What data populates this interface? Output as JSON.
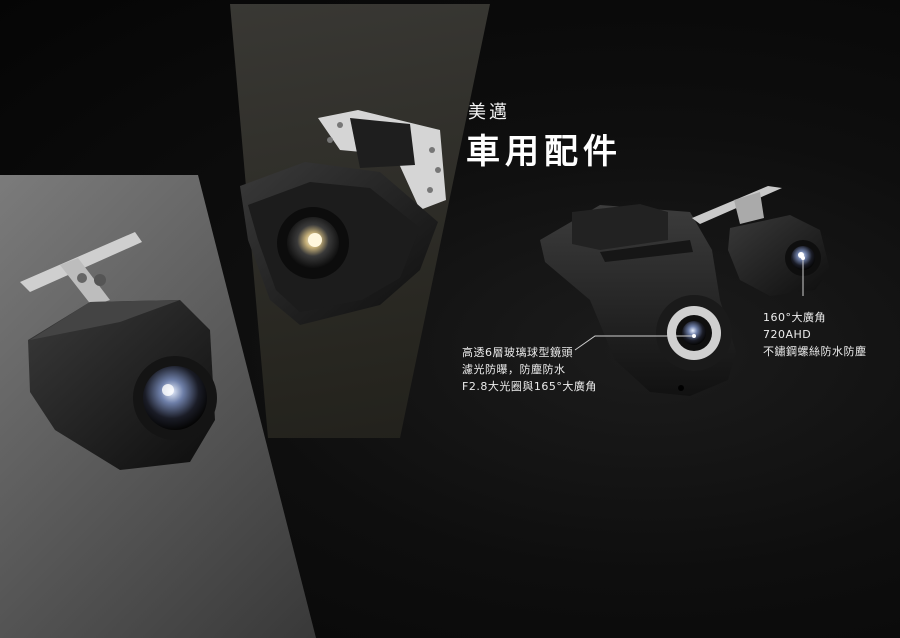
{
  "header": {
    "brand": "美邁",
    "title": "車用配件"
  },
  "annotations": {
    "dashcam_lens": [
      "高透6層玻璃球型鏡頭",
      "濾光防曝，防塵防水",
      "F2.8大光圈與165°大廣角"
    ],
    "rear_camera": [
      "160°大廣角",
      "720AHD",
      "不鏽鋼螺絲防水防塵"
    ]
  },
  "colors": {
    "background": "#0b0b0b",
    "text": "#ececec",
    "lens_ring": "#c9c9c9"
  }
}
